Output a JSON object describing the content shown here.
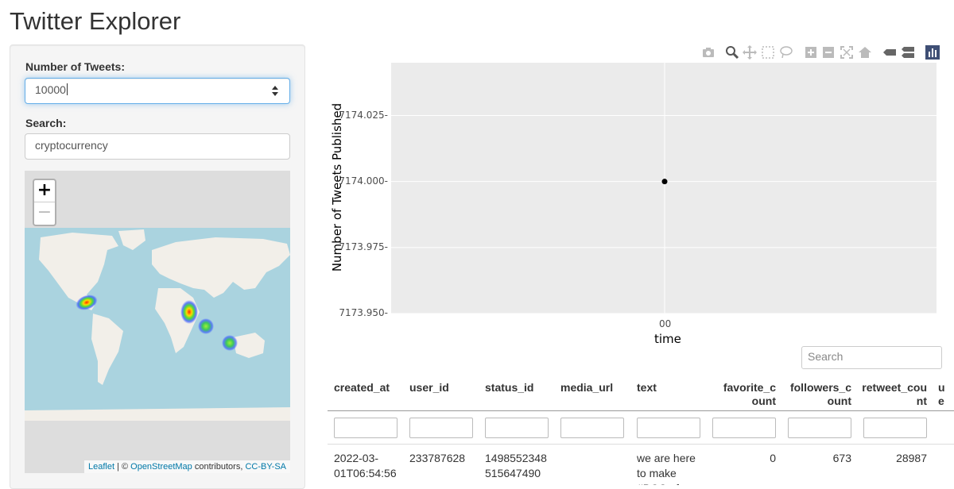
{
  "app": {
    "title": "Twitter Explorer"
  },
  "sidebar": {
    "tweets_label": "Number of Tweets:",
    "tweets_value": "10000",
    "search_label": "Search:",
    "search_value": "cryptocurrency"
  },
  "map": {
    "zoom_in": "+",
    "zoom_out": "−",
    "attribution": {
      "leaflet": "Leaflet",
      "sep1": " | © ",
      "osm": "OpenStreetMap",
      "contrib": " contributors, ",
      "license": "CC-BY-SA"
    }
  },
  "plot_toolbar": {
    "icons": [
      "camera-icon",
      "zoom-icon",
      "pan-icon",
      "box-select-icon",
      "lasso-icon",
      "zoom-in-icon",
      "zoom-out-icon",
      "autoscale-icon",
      "reset-axes-icon",
      "hover-closest-icon",
      "hover-compare-icon",
      "plotly-logo-icon"
    ]
  },
  "chart_data": {
    "type": "scatter",
    "title": "",
    "xlabel": "time",
    "ylabel": "Number of Tweets Published",
    "x_tick_labels": [
      "00"
    ],
    "y_tick_labels": [
      "7174.025",
      "7174.000",
      "7173.975",
      "7173.950"
    ],
    "ylim": [
      7173.95,
      7174.045
    ],
    "series": [
      {
        "x": [
          "00"
        ],
        "y": [
          7174.0
        ]
      }
    ],
    "grid": true
  },
  "table": {
    "search_placeholder": "Search",
    "columns": [
      "created_at",
      "user_id",
      "status_id",
      "media_url",
      "text",
      "favorite_count",
      "followers_count",
      "retweet_count",
      "u..."
    ],
    "header_lines": [
      [
        "created_at"
      ],
      [
        "user_id"
      ],
      [
        "status_id"
      ],
      [
        "media_url"
      ],
      [
        "text"
      ],
      [
        "favorite_c",
        "ount"
      ],
      [
        "followers_c",
        "ount"
      ],
      [
        "retweet_cou",
        "nt"
      ],
      [
        "u",
        "e"
      ]
    ],
    "rows": [
      {
        "created_at": [
          "2022-03-",
          "01T06:54:56"
        ],
        "user_id": [
          "233787628"
        ],
        "status_id": [
          "1498552348",
          "515647490"
        ],
        "media_url": [
          ""
        ],
        "text": [
          "we are here",
          "to make",
          "#BCC of"
        ],
        "favorite_count": [
          "0"
        ],
        "followers_count": [
          "673"
        ],
        "retweet_count": [
          "28987"
        ]
      }
    ]
  }
}
